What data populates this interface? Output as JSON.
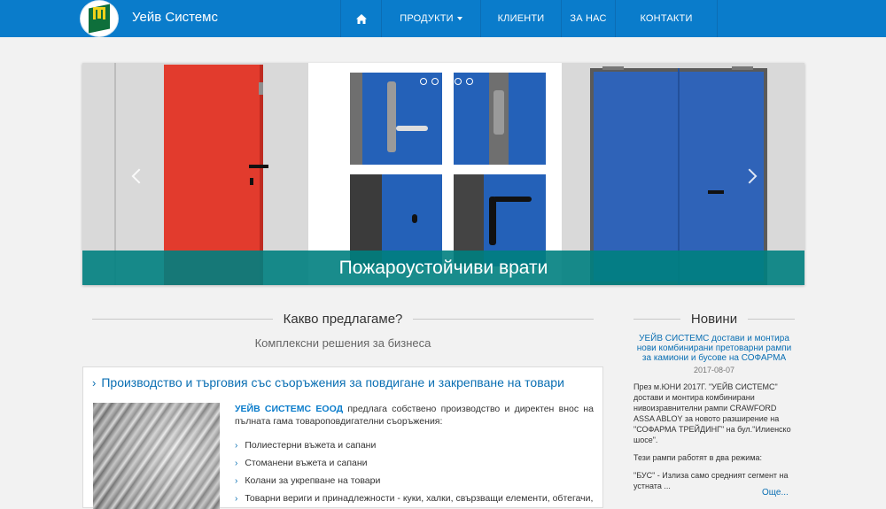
{
  "brand": {
    "name": "Уейв Системс"
  },
  "nav": {
    "items": [
      {
        "label": "",
        "icon": "home-icon"
      },
      {
        "label": "ПРОДУКТИ",
        "has_dropdown": true
      },
      {
        "label": "КЛИЕНТИ"
      },
      {
        "label": "ЗА НАС"
      },
      {
        "label": "КОНТАКТИ"
      }
    ]
  },
  "slider": {
    "caption": "Пожароустойчиви врати",
    "slide_count": 5,
    "active_slide": 3
  },
  "offer": {
    "heading": "Какво предлагаме?",
    "subheading": "Комплексни решения за бизнеса",
    "card_title": "Производство и търговия със съоръжения за повдигане и закрепване на товари",
    "company": "УЕЙВ СИСТЕМС ЕООД",
    "intro": " предлага собствено производство и директен внос на пълната гама товароповдигателни съоръжения:",
    "items": [
      "Полиестерни въжета и сапани",
      "Стоманени въжета и сапани",
      "Колани за укрепване на товари",
      "Товарни вериги и принадлежности - куки, халки, свързващи елементи, обтегачи,"
    ]
  },
  "news": {
    "heading": "Новини",
    "title": "УЕЙВ СИСТЕМС достави и монтира нови комбинирани претоварни рампи за камиони и бусове на СОФАРМА",
    "date": "2017-08-07",
    "paragraphs": [
      "През м.ЮНИ 2017Г. \"УЕЙВ СИСТЕМС\" достави и монтира комбинирани нивоизравнителни рампи CRAWFORD ASSA ABLOY за новото разширение на \"СОФАРМА ТРЕЙДИНГ\" на бул.\"Илиенско шосе\".",
      "Тези рампи работят в два режима:",
      "\"БУС\" - Излиза само средният сегмент на устната ..."
    ],
    "more": "Още..."
  },
  "colors": {
    "nav_bg": "#0a7ccb",
    "caption_bg": "#008080",
    "link": "#0a6fb3"
  }
}
